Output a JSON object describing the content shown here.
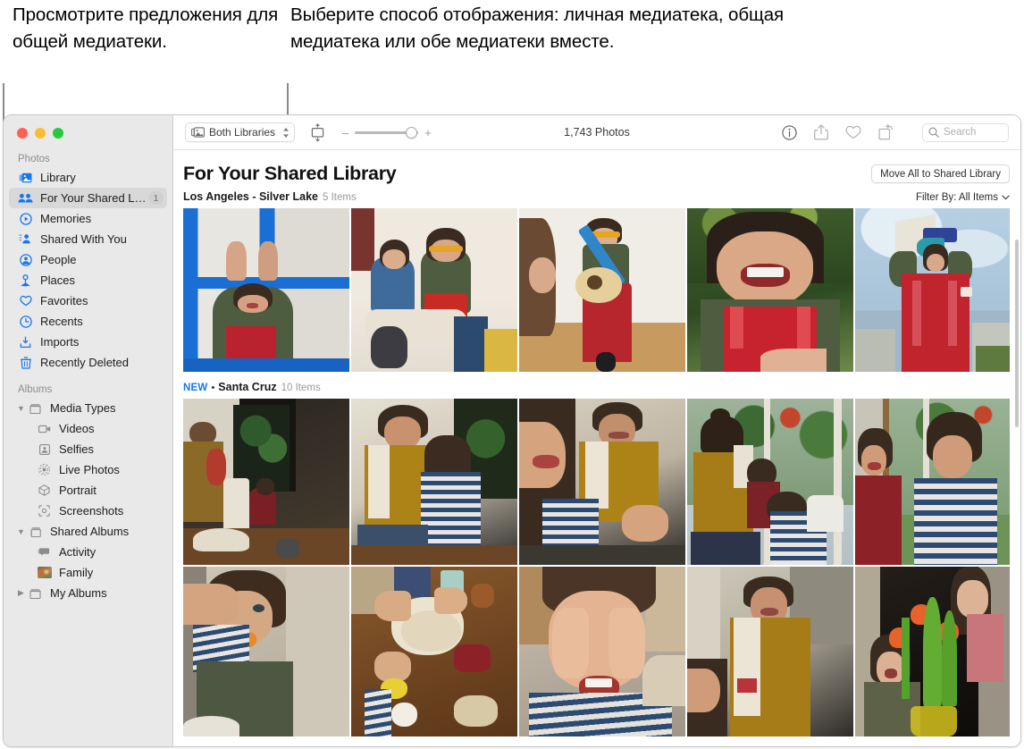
{
  "callouts": {
    "left": "Просмотрите предложения для общей медиатеки.",
    "right": "Выберите способ отображения: личная медиатека, общая медиатека или обе медиатеки вместе."
  },
  "window": {
    "traffic_lights": [
      "close",
      "minimize",
      "zoom"
    ]
  },
  "toolbar": {
    "library_picker_label": "Both Libraries",
    "library_picker_icon": "photo-stack-icon",
    "aspect_icon": "aspect-ratio-icon",
    "zoom_minus": "–",
    "zoom_plus": "+",
    "zoom_value_percent": 80,
    "photo_count": "1,743 Photos",
    "icons": [
      {
        "name": "info-icon",
        "glyph": "i"
      },
      {
        "name": "share-icon",
        "glyph": "share"
      },
      {
        "name": "favorite-heart-icon",
        "glyph": "heart"
      },
      {
        "name": "rotate-icon",
        "glyph": "rotate"
      }
    ],
    "search_placeholder": "Search",
    "search_value": ""
  },
  "sidebar": {
    "sections": [
      {
        "label": "Photos",
        "items": [
          {
            "label": "Library",
            "icon": "library-icon",
            "selected": false,
            "badge": ""
          },
          {
            "label": "For Your Shared Library",
            "icon": "shared-library-people-icon",
            "selected": true,
            "badge": "1"
          },
          {
            "label": "Memories",
            "icon": "memories-icon",
            "selected": false,
            "badge": ""
          },
          {
            "label": "Shared With You",
            "icon": "shared-with-you-icon",
            "selected": false,
            "badge": ""
          },
          {
            "label": "People",
            "icon": "people-icon",
            "selected": false,
            "badge": ""
          },
          {
            "label": "Places",
            "icon": "places-pin-icon",
            "selected": false,
            "badge": ""
          },
          {
            "label": "Favorites",
            "icon": "heart-icon",
            "selected": false,
            "badge": ""
          },
          {
            "label": "Recents",
            "icon": "clock-icon",
            "selected": false,
            "badge": ""
          },
          {
            "label": "Imports",
            "icon": "import-icon",
            "selected": false,
            "badge": ""
          },
          {
            "label": "Recently Deleted",
            "icon": "trash-icon",
            "selected": false,
            "badge": ""
          }
        ]
      },
      {
        "label": "Albums",
        "items": [
          {
            "label": "Media Types",
            "icon": "album-box-icon",
            "chevron": "down",
            "level": "group"
          },
          {
            "label": "Videos",
            "icon": "video-camera-icon",
            "level": "child"
          },
          {
            "label": "Selfies",
            "icon": "selfie-portrait-icon",
            "level": "child"
          },
          {
            "label": "Live Photos",
            "icon": "live-photos-icon",
            "level": "child"
          },
          {
            "label": "Portrait",
            "icon": "portrait-cube-icon",
            "level": "child"
          },
          {
            "label": "Screenshots",
            "icon": "screenshot-icon",
            "level": "child"
          },
          {
            "label": "Shared Albums",
            "icon": "shared-album-icon",
            "chevron": "down",
            "level": "group"
          },
          {
            "label": "Activity",
            "icon": "activity-bubbles-icon",
            "level": "child"
          },
          {
            "label": "Family",
            "icon": "family-album-thumbnail",
            "level": "child"
          },
          {
            "label": "My Albums",
            "icon": "album-box-icon",
            "chevron": "right",
            "level": "group"
          }
        ]
      }
    ]
  },
  "main": {
    "page_title": "For Your Shared Library",
    "move_all_label": "Move All to Shared Library",
    "filter_label": "Filter By: All Items",
    "filter_chevron": "chevron-down-icon",
    "sections": [
      {
        "new": false,
        "new_label": "NEW",
        "title": "Los Angeles - Silver Lake",
        "count": "5 Items",
        "rows": [
          [
            {
              "alt": "child-at-blue-window-waving",
              "scene": "window-boy"
            },
            {
              "alt": "two-children-sitting-with-red-box",
              "scene": "two-kids"
            },
            {
              "alt": "child-playing-blue-guitar",
              "scene": "guitar-kid"
            },
            {
              "alt": "smiling-child-in-red-overalls-outdoors",
              "scene": "smiling-kid"
            },
            {
              "alt": "child-with-paper-megaphone-against-sky",
              "scene": "megaphone-kid"
            }
          ]
        ]
      },
      {
        "new": true,
        "new_label": "NEW",
        "title": "Santa Cruz",
        "count": "10 Items",
        "rows": [
          [
            {
              "alt": "mother-and-child-baking-at-table",
              "scene": "baking-wide"
            },
            {
              "alt": "mother-helping-child-in-striped-shirt",
              "scene": "mother-child"
            },
            {
              "alt": "smiling-mother-with-child-foreground",
              "scene": "mother-smiling"
            },
            {
              "alt": "family-by-the-window",
              "scene": "window-family"
            },
            {
              "alt": "two-children-by-glass-door",
              "scene": "two-kids-door"
            }
          ],
          [
            {
              "alt": "child-eating-with-adult-hand",
              "scene": "child-eating"
            },
            {
              "alt": "hands-kneading-dough-on-table",
              "scene": "dough-hands"
            },
            {
              "alt": "child-with-floury-hands-on-face",
              "scene": "floury-face"
            },
            {
              "alt": "woman-with-towel-smiling",
              "scene": "woman-towel"
            },
            {
              "alt": "child-and-baby-with-orange-tulips",
              "scene": "tulips-baby"
            }
          ]
        ]
      }
    ]
  },
  "colors": {
    "accent": "#1476f0",
    "sidebar_bg": "#e9e9e9",
    "selected_bg": "#d8d8d8",
    "traffic_red": "#ff5f57",
    "traffic_yellow": "#febc2e",
    "traffic_green": "#28c840"
  }
}
